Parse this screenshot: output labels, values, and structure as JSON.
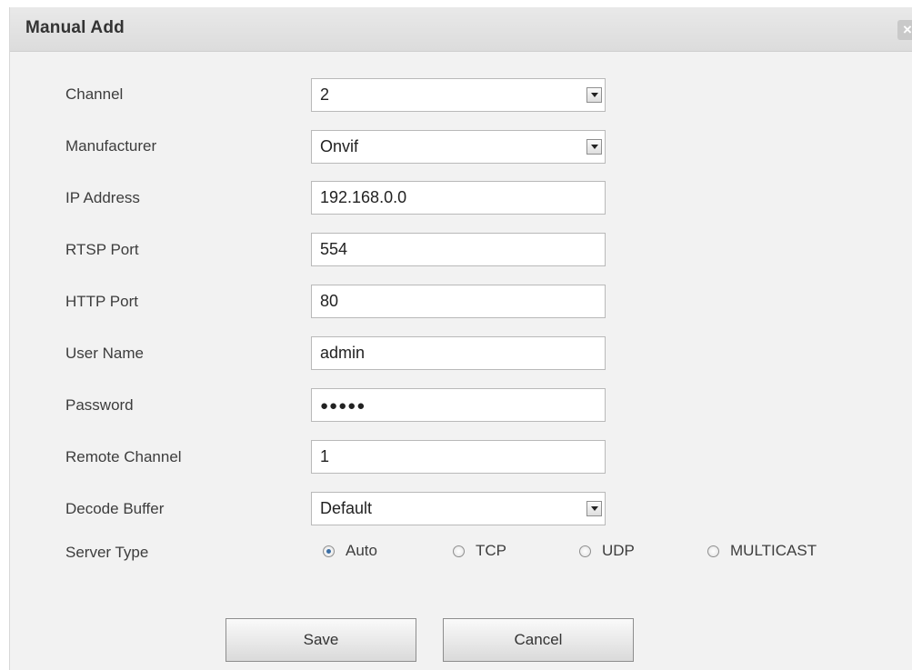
{
  "dialog": {
    "title": "Manual Add",
    "close_label": "×"
  },
  "form": {
    "channel": {
      "label": "Channel",
      "value": "2"
    },
    "manufacturer": {
      "label": "Manufacturer",
      "value": "Onvif"
    },
    "ip_address": {
      "label": "IP Address",
      "value": "192.168.0.0"
    },
    "rtsp_port": {
      "label": "RTSP Port",
      "value": "554"
    },
    "http_port": {
      "label": "HTTP Port",
      "value": "80"
    },
    "user_name": {
      "label": "User Name",
      "value": "admin"
    },
    "password": {
      "label": "Password",
      "value": "●●●●●"
    },
    "remote_channel": {
      "label": "Remote Channel",
      "value": "1"
    },
    "decode_buffer": {
      "label": "Decode Buffer",
      "value": "Default"
    },
    "server_type": {
      "label": "Server Type",
      "options": [
        "Auto",
        "TCP",
        "UDP",
        "MULTICAST"
      ],
      "selected": "Auto"
    }
  },
  "buttons": {
    "save": "Save",
    "cancel": "Cancel"
  },
  "icons": {
    "close": "close-icon",
    "dropdown": "chevron-down-icon"
  }
}
